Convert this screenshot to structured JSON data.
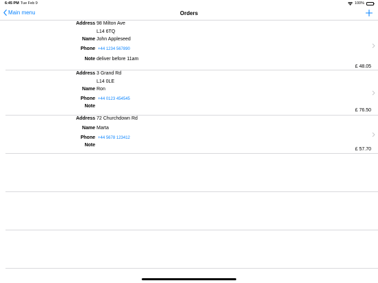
{
  "status_bar": {
    "time": "6:45 PM",
    "date": "Tue Feb 9",
    "battery": "100%"
  },
  "nav": {
    "back_label": "Main menu",
    "title": "Orders"
  },
  "labels": {
    "address": "Address",
    "name": "Name",
    "phone": "Phone",
    "note": "Note"
  },
  "orders": [
    {
      "address_line1": "98 Milton Ave",
      "address_line2": "L14 6TQ",
      "name": "John Appleseed",
      "phone": "+44 1234 567890",
      "note": "deliver before 11am",
      "price": "£ 48.05"
    },
    {
      "address_line1": "3 Grand Rd",
      "address_line2": "L14 0LE",
      "name": "Ron",
      "phone": "+44 0123 454545",
      "note": "",
      "price": "£ 76.50"
    },
    {
      "address_line1": "72 Churchdown Rd",
      "address_line2": "",
      "name": "Marta",
      "phone": "+44 5678 123412",
      "note": "",
      "price": "£ 57.70"
    }
  ]
}
